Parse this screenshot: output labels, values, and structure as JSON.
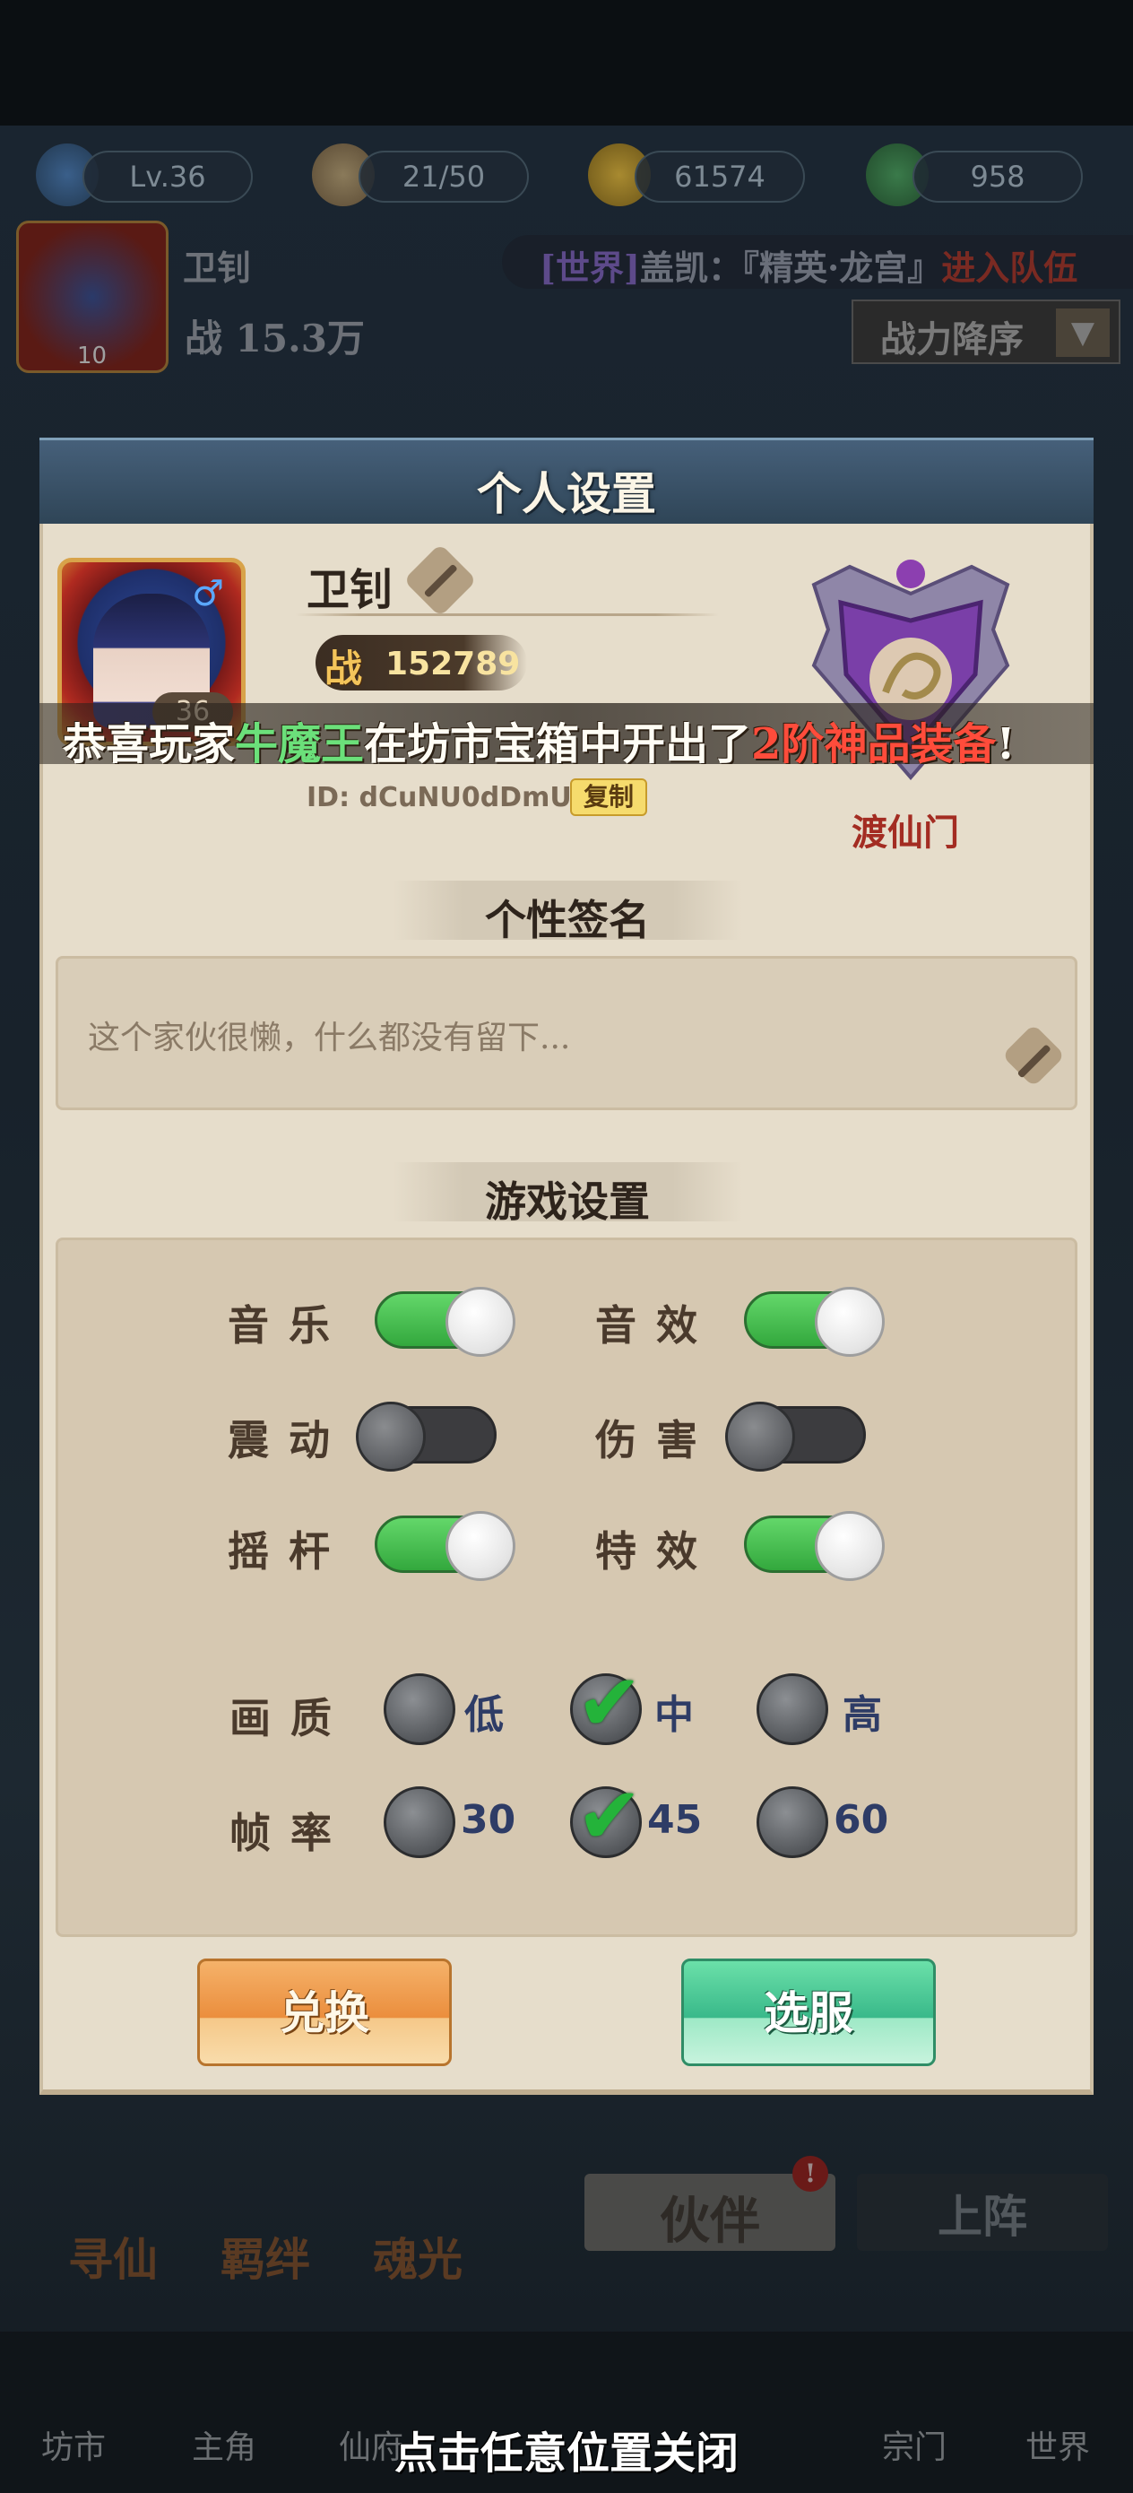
{
  "hud": {
    "level": "Lv.36",
    "stamina": "21/50",
    "coins": "61574",
    "gems": "958",
    "player_name": "卫钊",
    "power": "战 15.3万",
    "avatar_level": "10",
    "chat_channel": "[世界]",
    "chat_message": "盖凯：『精英·龙宫』",
    "chat_action": "进入队伍",
    "sort_label": "战力降序"
  },
  "background": {
    "tab_partner": "伙伴",
    "tab_deploy": "上阵",
    "round_buttons": [
      "寻仙",
      "羁绊",
      "魂光"
    ],
    "nav": [
      "坊市",
      "主角",
      "仙府",
      "",
      "宗门",
      "世界"
    ]
  },
  "modal": {
    "title": "个人设置",
    "player_name": "卫钊",
    "level": "36",
    "power_label": "战",
    "power_value": "152789",
    "id_text": "ID: dCuNU0dDmU",
    "copy_label": "复制",
    "sect_name": "渡仙门",
    "signature_header": "个性签名",
    "signature_text": "这个家伙很懒，什么都没有留下...",
    "settings_header": "游戏设置",
    "toggles": [
      {
        "label": "音乐",
        "state": "on"
      },
      {
        "label": "音效",
        "state": "on"
      },
      {
        "label": "震动",
        "state": "off"
      },
      {
        "label": "伤害",
        "state": "off"
      },
      {
        "label": "摇杆",
        "state": "on"
      },
      {
        "label": "特效",
        "state": "on"
      }
    ],
    "quality": {
      "label": "画质",
      "options": [
        "低",
        "中",
        "高"
      ],
      "selected": "中"
    },
    "framerate": {
      "label": "帧率",
      "options": [
        "30",
        "45",
        "60"
      ],
      "selected": "45"
    },
    "redeem_button": "兑换",
    "server_button": "选服"
  },
  "marquee": {
    "prefix": "恭喜玩家",
    "player": "牛魔王",
    "middle": "在坊市宝箱中开出了",
    "item": "2阶神品装备",
    "suffix": "!"
  },
  "close_hint": "点击任意位置关闭",
  "colors": {
    "toggle_on": "#33a83d",
    "check": "#24b33a",
    "sect_name": "#a32c22",
    "marquee_highlight_green": "#6be07a",
    "marquee_highlight_red": "#ff4c3b"
  }
}
